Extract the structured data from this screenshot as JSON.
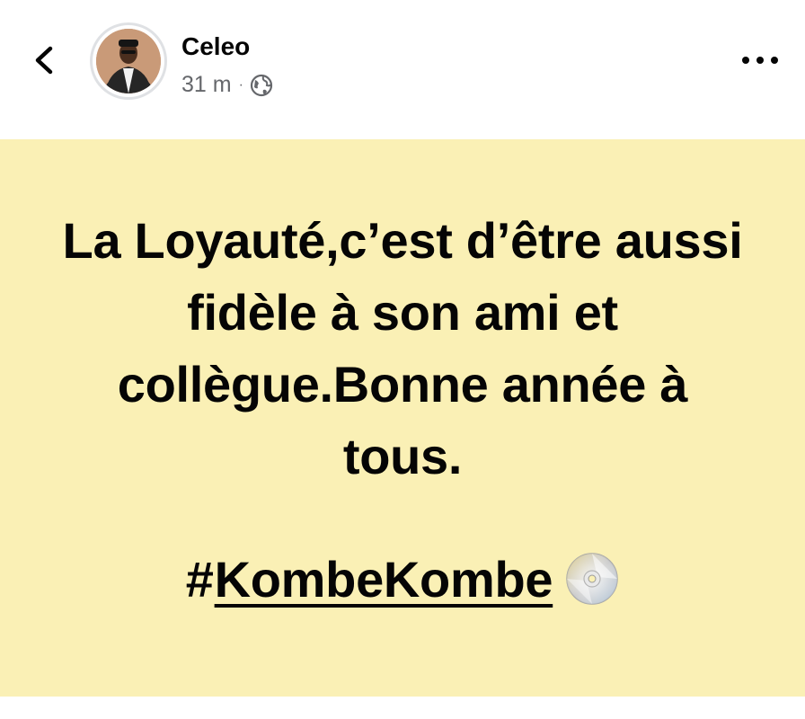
{
  "header": {
    "back_icon": "chevron-left-icon",
    "author_name": "Celeo",
    "timestamp": "31 m",
    "separator": "·",
    "privacy_icon": "globe-icon",
    "more_icon": "more-horizontal-icon"
  },
  "post": {
    "background_color": "#faf0b5",
    "text": "La Loyauté,c’est d’être aussi fidèle à son ami et collègue.Bonne année à tous.",
    "hashtag_prefix": "#",
    "hashtag": "KombeKombe",
    "emoji_icon": "optical-disc-icon"
  }
}
